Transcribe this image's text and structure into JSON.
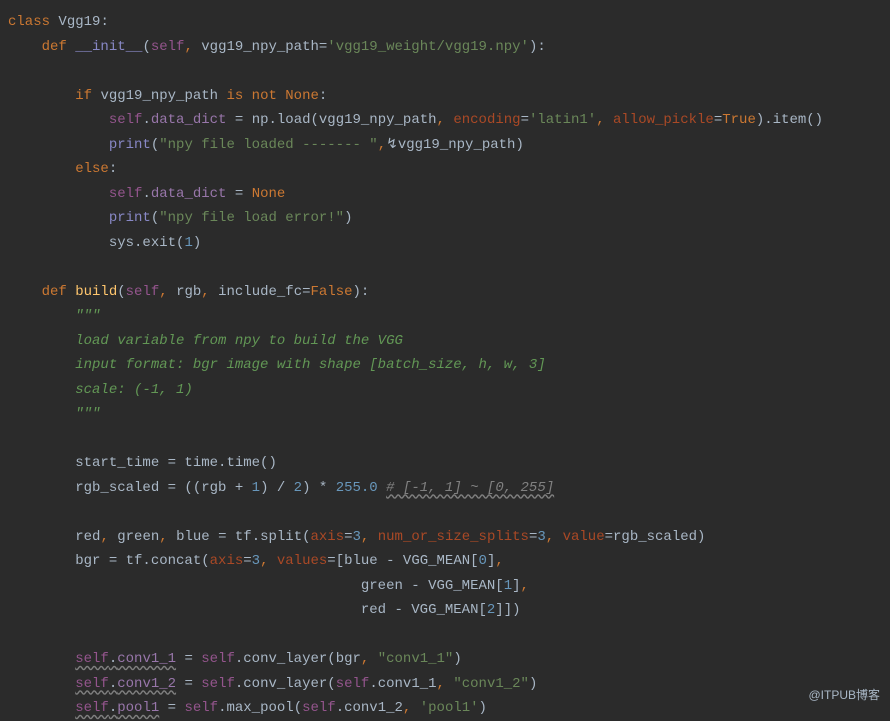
{
  "watermark": "@ITPUB博客",
  "code": {
    "l1": {
      "class": "class ",
      "name": "Vgg19",
      "colon": ":"
    },
    "l2": {
      "def": "def ",
      "fn": "__init__",
      "op": "(self",
      "comma1": ", ",
      "p2": "vgg19_npy_path",
      "eq": "=",
      "str": "'vgg19_weight/vgg19.npy'",
      "end": "):"
    },
    "l3": "",
    "l4": {
      "if": "if ",
      "var": "vgg19_npy_path ",
      "is": "is not ",
      "none": "None",
      "colon": ":"
    },
    "l5": {
      "self": "self",
      "dot": ".",
      "attr": "data_dict",
      "eq": " = ",
      "np": "np.load(vgg19_npy_path",
      "c1": ", ",
      "kw1": "encoding",
      "e1": "=",
      "s1": "'latin1'",
      "c2": ", ",
      "kw2": "allow_pickle",
      "e2": "=",
      "true": "True",
      "end": ").item()"
    },
    "l6": {
      "print": "print",
      "op": "(",
      "s": "\"npy file loaded ------- \"",
      "c": ",",
      "cur": "↯",
      "var": "vgg19_npy_path)"
    },
    "l7": {
      "else": "else",
      "colon": ":"
    },
    "l8": {
      "self": "self",
      "dot": ".",
      "attr": "data_dict",
      "eq": " = ",
      "none": "None"
    },
    "l9": {
      "print": "print",
      "paren": "(",
      "s": "\"npy file load error!\"",
      "end": ")"
    },
    "l10": {
      "sys": "sys.exit(",
      "n": "1",
      "end": ")"
    },
    "l11": "",
    "l12": {
      "def": "def ",
      "fn": "build",
      "op": "(",
      "self": "self",
      "c1": ", ",
      "p1": "rgb",
      "c2": ", ",
      "p2": "include_fc",
      "eq": "=",
      "false": "False",
      "end": "):"
    },
    "l13": {
      "q": "\"\"\""
    },
    "l14": {
      "t": "load variable from npy to build the VGG"
    },
    "l15": {
      "t": "input format: bgr image with shape [batch_size, h, w, 3]"
    },
    "l16": {
      "t": "scale: (-1, 1)"
    },
    "l17": {
      "q": "\"\"\""
    },
    "l18": "",
    "l19": {
      "var": "start_time = time.time()"
    },
    "l20": {
      "var": "rgb_scaled = ((rgb + ",
      "n1": "1",
      "m": ") / ",
      "n2": "2",
      "m2": ") * ",
      "n3": "255.0 ",
      "com": "# [-1, 1] ~ [0, 255]"
    },
    "l21": "",
    "l22": {
      "a": "red",
      "c1": ", ",
      "b": "green",
      "c2": ", ",
      "c": "blue = tf.split(",
      "kw1": "axis",
      "e1": "=",
      "n1": "3",
      "cc1": ", ",
      "kw2": "num_or_size_splits",
      "e2": "=",
      "n2": "3",
      "cc2": ", ",
      "kw3": "value",
      "e3": "=",
      "v": "rgb_scaled)"
    },
    "l23": {
      "a": "bgr = tf.concat(",
      "kw1": "axis",
      "e1": "=",
      "n1": "3",
      "c1": ", ",
      "kw2": "values",
      "e2": "=",
      "b": "[blue - VGG_MEAN[",
      "n2": "0",
      "end": "]",
      "cc": ","
    },
    "l24": {
      "a": "green - VGG_MEAN[",
      "n": "1",
      "end": "]",
      "cc": ","
    },
    "l25": {
      "a": "red - VGG_MEAN[",
      "n": "2",
      "end": "]])"
    },
    "l26": "",
    "l27": {
      "self": "self",
      "dot": ".",
      "attr": "conv1_1",
      "eq": " = ",
      "s2": "self",
      "rest": ".conv_layer(bgr",
      "c": ", ",
      "str": "\"conv1_1\"",
      "end": ")"
    },
    "l28": {
      "self": "self",
      "dot": ".",
      "attr": "conv1_2",
      "eq": " = ",
      "s2": "self",
      "rest": ".conv_layer(",
      "s3": "self",
      "r2": ".conv1_1",
      "c": ", ",
      "str": "\"conv1_2\"",
      "end": ")"
    },
    "l29": {
      "self": "self",
      "dot": ".",
      "attr": "pool1",
      "eq": " = ",
      "s2": "self",
      "rest": ".max_pool(",
      "s3": "self",
      "r2": ".conv1_2",
      "c": ", ",
      "str": "'pool1'",
      "end": ")"
    }
  }
}
